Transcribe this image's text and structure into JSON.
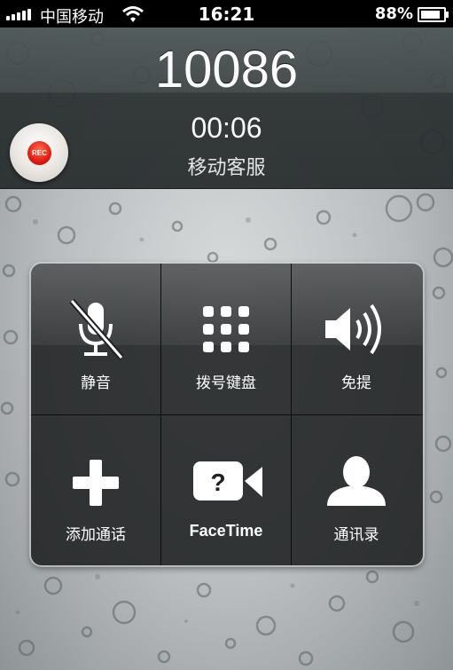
{
  "status_bar": {
    "carrier": "中国移动",
    "time": "16:21",
    "battery_percent": "88%",
    "battery_level": 0.88,
    "wifi_icon": "wifi-icon"
  },
  "call": {
    "number": "10086",
    "duration": "00:06",
    "label": "移动客服",
    "rec_label": "REC"
  },
  "controls": [
    {
      "label": "静音",
      "icon": "mute-icon"
    },
    {
      "label": "拨号键盘",
      "icon": "keypad-icon"
    },
    {
      "label": "免提",
      "icon": "speaker-icon"
    },
    {
      "label": "添加通话",
      "icon": "add-call-icon"
    },
    {
      "label": "FaceTime",
      "icon": "facetime-icon"
    },
    {
      "label": "通讯录",
      "icon": "contacts-icon"
    }
  ],
  "colors": {
    "rec_red": "#e21d12",
    "status_bar": "#000000",
    "panel": "#1e2021"
  }
}
